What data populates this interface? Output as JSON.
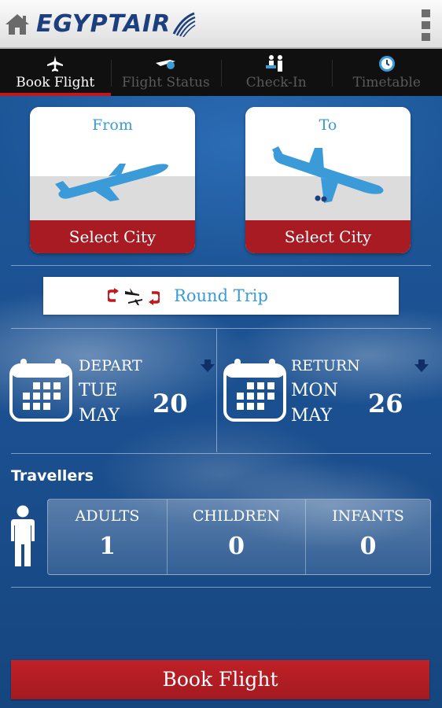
{
  "header": {
    "logo_text": "EGYPTAIR",
    "brand_color": "#1d3f7d"
  },
  "tabs": [
    {
      "label": "Book Flight",
      "icon": "plane-icon",
      "active": true
    },
    {
      "label": "Flight Status",
      "icon": "flight-status-icon",
      "active": false
    },
    {
      "label": "Check-In",
      "icon": "check-in-icon",
      "active": false
    },
    {
      "label": "Timetable",
      "icon": "clock-icon",
      "active": false
    }
  ],
  "from_card": {
    "heading": "From",
    "action": "Select City",
    "icon": "plane-takeoff-icon"
  },
  "to_card": {
    "heading": "To",
    "action": "Select City",
    "icon": "plane-landing-icon"
  },
  "trip_type": {
    "label": "Round Trip",
    "icon": "round-trip-icon"
  },
  "depart": {
    "kind": "DEPART",
    "weekday": "TUE",
    "month": "MAY",
    "day": "20"
  },
  "return": {
    "kind": "RETURN",
    "weekday": "MON",
    "month": "MAY",
    "day": "26"
  },
  "travellers": {
    "title": "Travellers",
    "adults_label": "ADULTS",
    "adults": "1",
    "children_label": "CHILDREN",
    "children": "0",
    "infants_label": "INFANTS",
    "infants": "0"
  },
  "book_button": "Book Flight",
  "colors": {
    "accent_red": "#a81b22",
    "accent_blue": "#3a9bd8",
    "background_blue": "#1b4f8f"
  }
}
